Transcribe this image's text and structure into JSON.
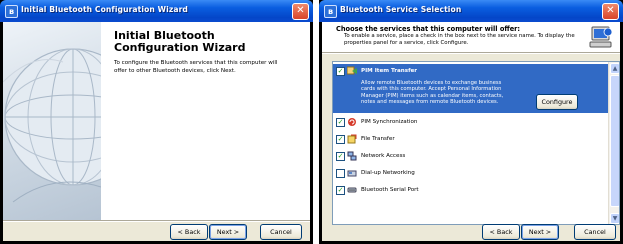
{
  "wizard": {
    "title_bar": "Initial Bluetooth Configuration Wizard",
    "heading": "Initial Bluetooth Configuration Wizard",
    "description": "To configure the Bluetooth services that this computer will offer to other Bluetooth devices, click Next.",
    "buttons": {
      "back": "< Back",
      "next": "Next >",
      "cancel": "Cancel"
    }
  },
  "service_selection": {
    "title_bar": "Bluetooth Service Selection",
    "header_title": "Choose the services that this computer will offer:",
    "header_subtitle": "To enable a service, place a check in the box next to the service name. To display the properties panel for a service, click Configure.",
    "configure_label": "Configure",
    "services": [
      {
        "label": "PIM Item Transfer",
        "checked": true,
        "selected": true,
        "icon": "pim-transfer-icon",
        "description": "Allow remote Bluetooth devices to exchange business cards with this computer. Accept Personal Information Manager (PIM) items such as calendar items, contacts, notes and messages from remote Bluetooth devices."
      },
      {
        "label": "PIM Synchronization",
        "checked": true,
        "selected": false,
        "icon": "pim-sync-icon"
      },
      {
        "label": "File Transfer",
        "checked": true,
        "selected": false,
        "icon": "file-transfer-icon"
      },
      {
        "label": "Network Access",
        "checked": true,
        "selected": false,
        "icon": "network-access-icon"
      },
      {
        "label": "Dial-up Networking",
        "checked": false,
        "selected": false,
        "icon": "dialup-icon"
      },
      {
        "label": "Bluetooth Serial Port",
        "checked": true,
        "selected": false,
        "icon": "serial-port-icon"
      }
    ],
    "buttons": {
      "back": "< Back",
      "next": "Next >",
      "cancel": "Cancel"
    }
  },
  "colors": {
    "title_bar": "#0a5ee0",
    "selection": "#316ac5",
    "dialog_face": "#ece9d8"
  }
}
